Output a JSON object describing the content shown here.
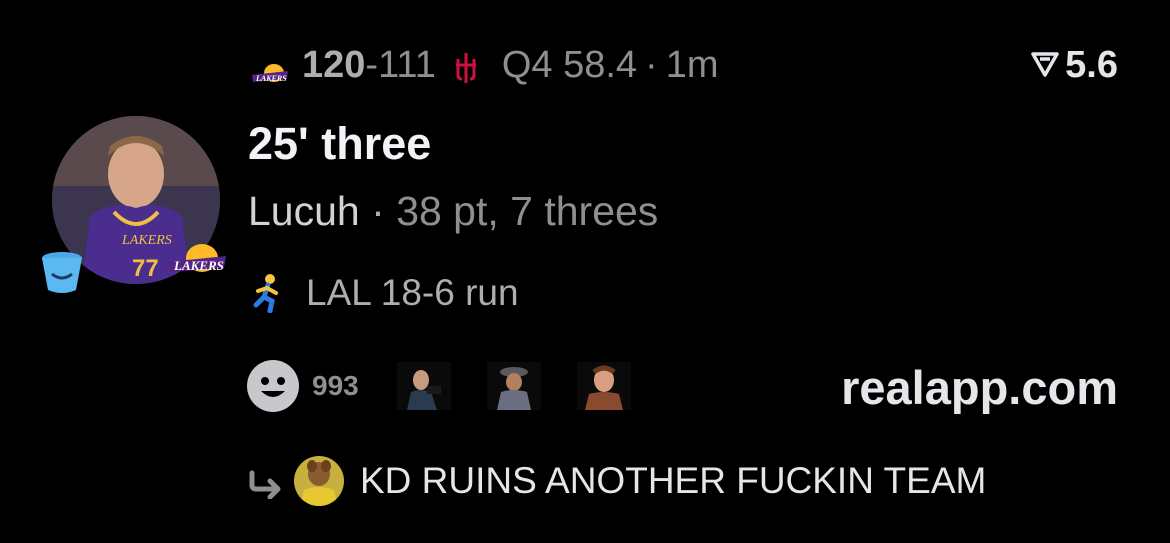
{
  "game": {
    "home_score": "120",
    "dash": "-",
    "away_score": "111",
    "clock": "Q4 58.4",
    "separator": "·",
    "posted_ago": "1m"
  },
  "boost": {
    "value": "5.6",
    "icon": "boost-icon"
  },
  "play": {
    "title": "25' three",
    "player_name": "Lucuh",
    "separator": "·",
    "player_stats": "38 pt, 7 threes",
    "run_text": "LAL 18-6 run"
  },
  "reactions": {
    "count": "993",
    "icon": "smiley-icon"
  },
  "brand": {
    "site": "realapp.com"
  },
  "reply": {
    "text": "KD RUINS ANOTHER FUCKIN TEAM"
  },
  "colors": {
    "background": "#000000",
    "lakers_purple": "#552583",
    "lakers_gold": "#FDB927",
    "rockets_red": "#CE1141",
    "muted_text": "#8e8e93"
  }
}
